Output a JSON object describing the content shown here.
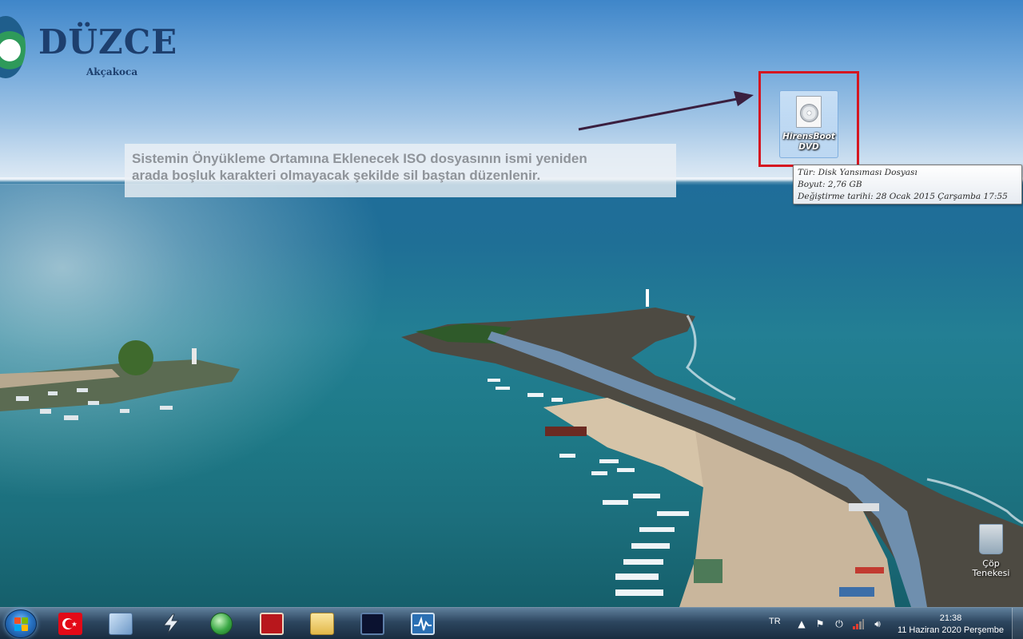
{
  "wallpaper": {
    "logo_title": "DÜZCE",
    "logo_subtitle": "Akçakoca"
  },
  "annotation": {
    "line1": "Sistemin Önyükleme Ortamına Eklenecek ISO dosyasının ismi yeniden",
    "line2": "arada boşluk karakteri olmayacak şekilde sil baştan düzenlenir.",
    "highlight_color": "#d51620",
    "arrow_color": "#3a1f3f"
  },
  "desktop_icon": {
    "icon": "iso-disc-image-icon",
    "label_line1": "HirensBoot",
    "label_line2": "DVD"
  },
  "tooltip": {
    "type": "Tür: Disk Yansıması Dosyası",
    "size": "Boyut: 2,76 GB",
    "modified": "Değiştirme tarihi: 28 Ocak 2015 Çarşamba 17:55"
  },
  "recycle_bin": {
    "label_line1": "Çöp",
    "label_line2": "Tenekesi"
  },
  "taskbar": {
    "start_icon": "windows-start-icon",
    "pinned": [
      {
        "name": "turkish-flag-app",
        "icon": "turkey-flag-icon"
      },
      {
        "name": "install-wizard",
        "icon": "installer-icon"
      },
      {
        "name": "network-tool",
        "icon": "lightning-tool-icon"
      },
      {
        "name": "web-browser",
        "icon": "green-globe-icon"
      },
      {
        "name": "red-app",
        "icon": "red-square-app-icon"
      },
      {
        "name": "file-explorer",
        "icon": "folder-icon"
      },
      {
        "name": "monitor-tool",
        "icon": "dark-terminal-icon"
      },
      {
        "name": "resource-monitor",
        "icon": "pulse-monitor-icon"
      }
    ],
    "language": "TR",
    "tray_icons": [
      "show-hidden-icons",
      "flag-icon",
      "power-plug-icon",
      "signal-bars-icon",
      "speaker-icon"
    ],
    "time": "21:38",
    "date": "11 Haziran 2020 Perşembe"
  }
}
